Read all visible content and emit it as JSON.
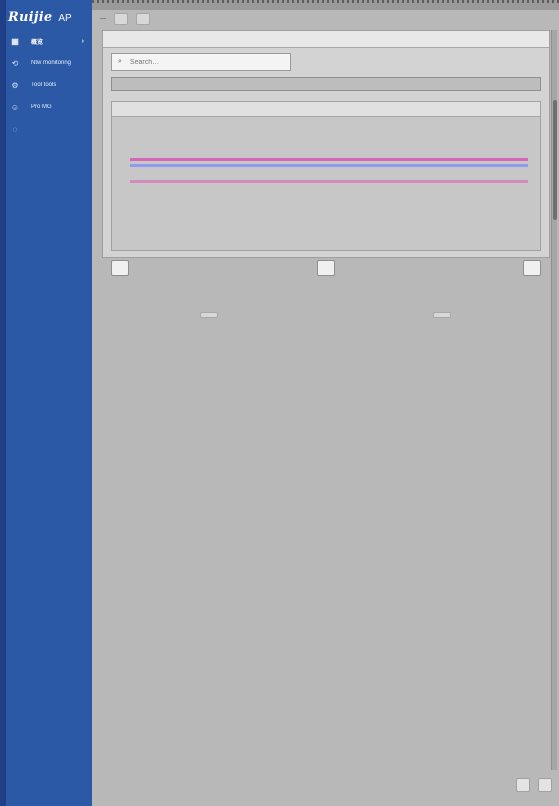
{
  "sidebar": {
    "brand": {
      "logo": "Ruijie",
      "product": "AP"
    },
    "items": [
      {
        "label": "概览",
        "icon": "dashboard-icon",
        "active": true,
        "chevron": "›"
      },
      {
        "label": "Ntw monitoring",
        "icon": "clock-icon",
        "active": false
      },
      {
        "label": "Tool tools",
        "icon": "wrench-icon",
        "active": false
      },
      {
        "label": "Pro MG",
        "icon": "user-icon",
        "active": false
      },
      {
        "label": "",
        "icon": "circle-icon",
        "active": false
      }
    ]
  },
  "main": {
    "header": {
      "left": "—",
      "pill_1": "",
      "pill_2": ""
    },
    "panel": {
      "search_placeholder": "Search…"
    },
    "footer": {
      "btn_left": "",
      "btn_mid": "",
      "btn_right": ""
    },
    "mid_labels": [
      "",
      ""
    ],
    "bottom_status": [
      "",
      ""
    ]
  },
  "colors": {
    "sidebar": "#2b59a6",
    "sidebar_edge": "#1f3f86",
    "main_bg": "#b8b8b8",
    "stripe_pink": "#d95ab3",
    "stripe_blue": "#7c8bff"
  }
}
